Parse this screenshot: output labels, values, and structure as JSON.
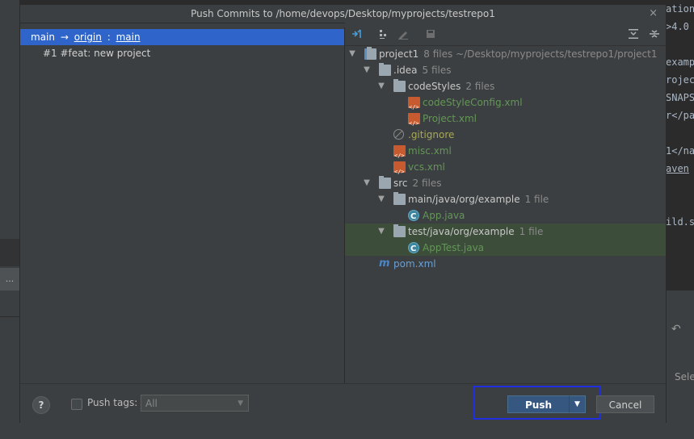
{
  "dialog": {
    "title": "Push Commits to /home/devops/Desktop/myprojects/testrepo1",
    "close": "×"
  },
  "commits": {
    "branch_local": "main",
    "arrow": "→",
    "remote": "origin",
    "separator": ":",
    "branch_remote": "main",
    "items": [
      {
        "label": "#1 #feat: new project"
      }
    ]
  },
  "tree": [
    {
      "name": "project1",
      "count": "8 files ~/Desktop/myprojects/testrepo1/project1"
    },
    {
      "name": ".idea",
      "count": "5 files"
    },
    {
      "name": "codeStyles",
      "count": "2 files"
    },
    {
      "name": "codeStyleConfig.xml",
      "count": ""
    },
    {
      "name": "Project.xml",
      "count": ""
    },
    {
      "name": ".gitignore",
      "count": ""
    },
    {
      "name": "misc.xml",
      "count": ""
    },
    {
      "name": "vcs.xml",
      "count": ""
    },
    {
      "name": "src",
      "count": "2 files"
    },
    {
      "name": "main/java/org/example",
      "count": "1 file"
    },
    {
      "name": "App.java",
      "count": ""
    },
    {
      "name": "test/java/org/example",
      "count": "1 file"
    },
    {
      "name": "AppTest.java",
      "count": ""
    },
    {
      "name": "pom.xml",
      "count": ""
    }
  ],
  "footer": {
    "help": "?",
    "push_tags_label": "Push tags:",
    "tags_value": "All",
    "push_label": "Push",
    "cancel_label": "Cancel"
  },
  "background": {
    "left_tool": "...",
    "editor_lines": [
      "ation",
      ">4.0",
      "examp",
      "rojec",
      "SNAPS",
      "r</pa",
      "1</na",
      "aven",
      "ild.s"
    ],
    "right_bottom_label": "Sele"
  },
  "colors": {
    "selection": "#2f65ca",
    "push_button": "#365880",
    "highlight_box": "#1f2fdf",
    "changed_file": "#6a9fd4",
    "new_file": "#629755"
  }
}
